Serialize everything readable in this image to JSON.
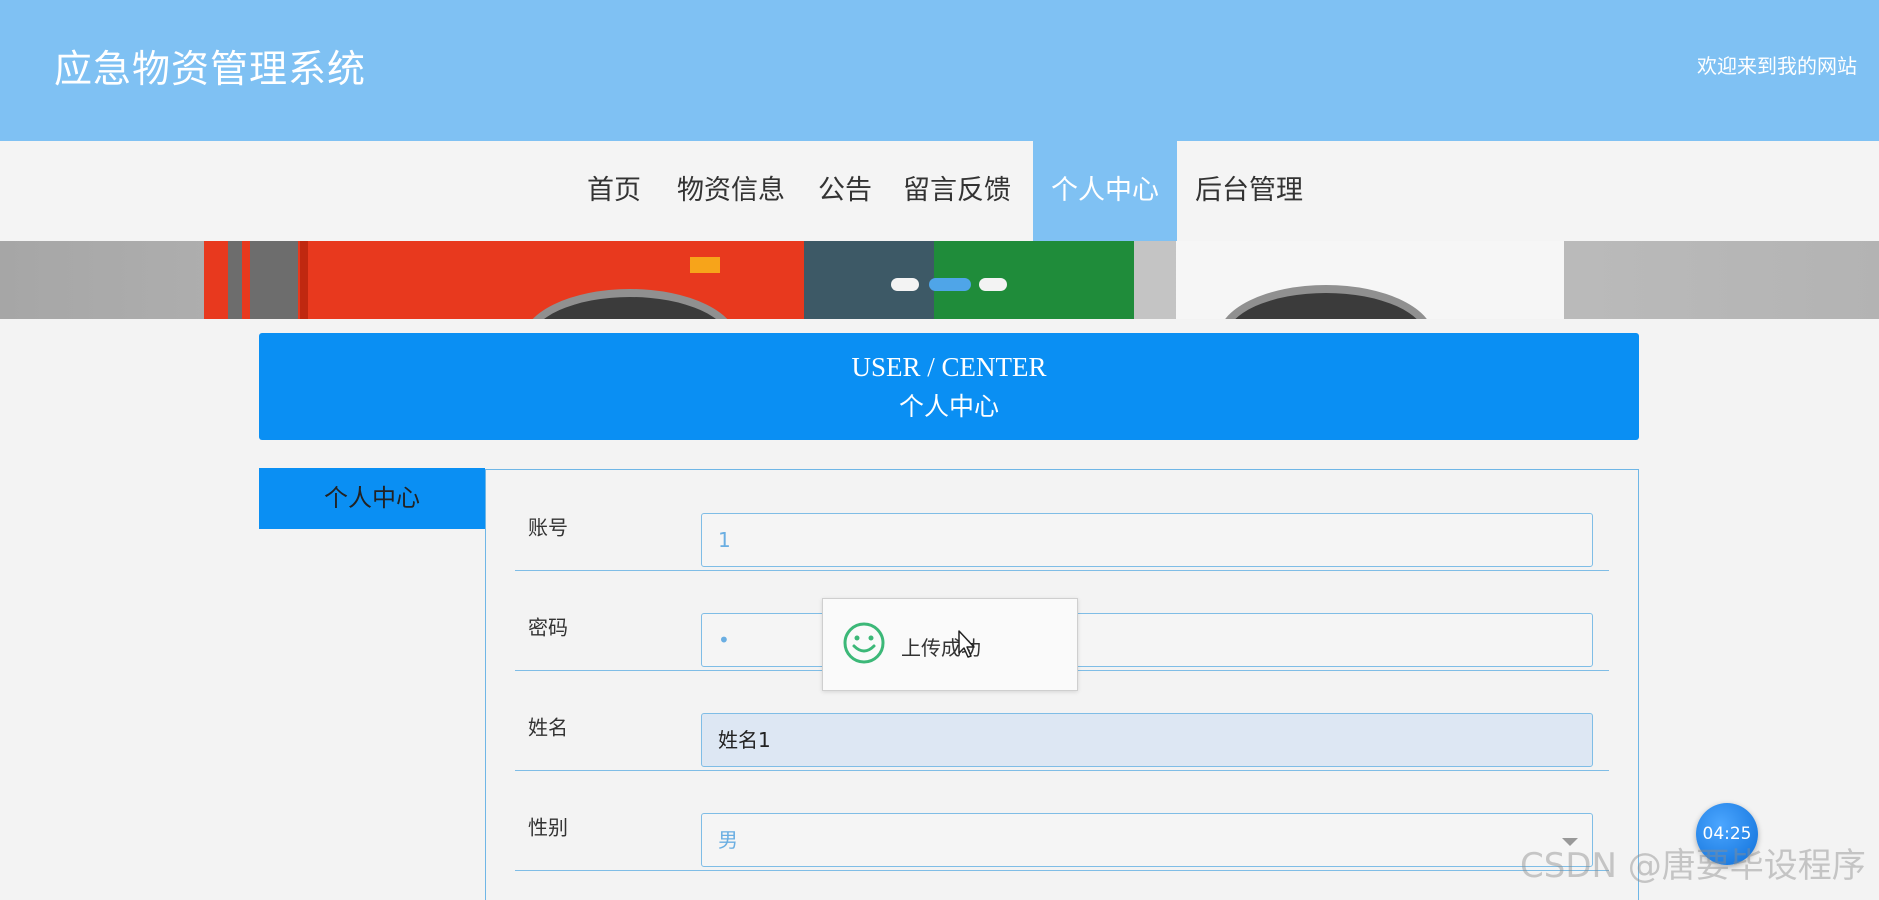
{
  "header": {
    "site_title": "应急物资管理系统",
    "welcome": "欢迎来到我的网站"
  },
  "nav": {
    "items": [
      {
        "label": "首页",
        "active": false
      },
      {
        "label": "物资信息",
        "active": false
      },
      {
        "label": "公告",
        "active": false
      },
      {
        "label": "留言反馈",
        "active": false
      },
      {
        "label": "个人中心",
        "active": true
      },
      {
        "label": "后台管理",
        "active": false
      }
    ]
  },
  "banner": {
    "slide_count": 3,
    "active_slide": 2
  },
  "user_center": {
    "title_en": "USER / CENTER",
    "title_cn": "个人中心"
  },
  "side_menu": {
    "items": [
      {
        "label": "个人中心",
        "active": true
      }
    ]
  },
  "form": {
    "fields": [
      {
        "label": "账号",
        "value": "1"
      },
      {
        "label": "密码",
        "value": "•"
      },
      {
        "label": "姓名",
        "value": "姓名1"
      },
      {
        "label": "性别",
        "value": "男",
        "type": "select"
      }
    ]
  },
  "toast": {
    "icon": "smile-icon",
    "message": "上传成功"
  },
  "overlay": {
    "timer": "04:25",
    "watermark": "CSDN @唐要毕设程序"
  },
  "colors": {
    "header_bg": "#7fc1f3",
    "primary": "#0a8ff3",
    "success": "#3cb878"
  }
}
